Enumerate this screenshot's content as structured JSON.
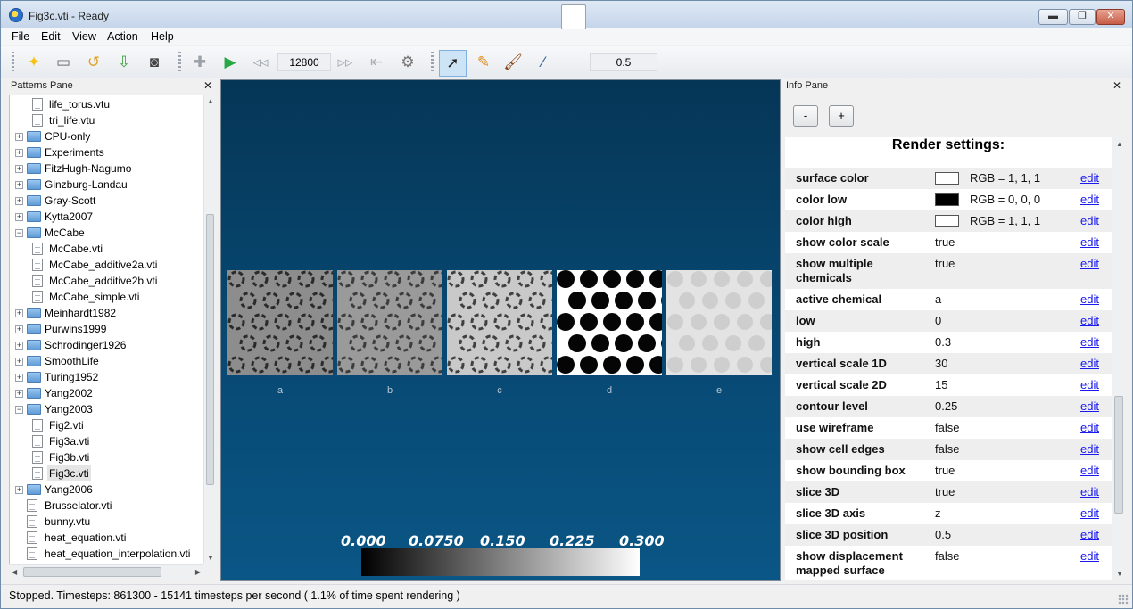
{
  "window": {
    "title": "Fig3c.vti - Ready",
    "minimize": "▬",
    "maximize": "❐",
    "close": "✕"
  },
  "menu": {
    "items": [
      {
        "label": "File"
      },
      {
        "label": "Edit"
      },
      {
        "label": "View"
      },
      {
        "label": "Action"
      },
      {
        "label": "Help"
      }
    ]
  },
  "toolbar": {
    "timesteps_value": "12800",
    "brush_value": "0.5",
    "icons": [
      "new-pattern-icon",
      "open-folder-icon",
      "reload-icon",
      "import-icon",
      "screenshot-icon",
      "add-icon",
      "run-icon",
      "slower-icon",
      "faster-icon",
      "reset-icon",
      "settings-icon",
      "pointer-icon",
      "pencil-icon",
      "brush-icon",
      "eyedropper-icon"
    ]
  },
  "patterns_pane": {
    "title": "Patterns Pane",
    "close": "✕",
    "tree": [
      {
        "label": "life_torus.vtu",
        "type": "file",
        "level": 1
      },
      {
        "label": "tri_life.vtu",
        "type": "file",
        "level": 1
      },
      {
        "label": "CPU-only",
        "type": "folder",
        "level": 0,
        "expanded": false
      },
      {
        "label": "Experiments",
        "type": "folder",
        "level": 0,
        "expanded": false
      },
      {
        "label": "FitzHugh-Nagumo",
        "type": "folder",
        "level": 0,
        "expanded": false
      },
      {
        "label": "Ginzburg-Landau",
        "type": "folder",
        "level": 0,
        "expanded": false
      },
      {
        "label": "Gray-Scott",
        "type": "folder",
        "level": 0,
        "expanded": false
      },
      {
        "label": "Kytta2007",
        "type": "folder",
        "level": 0,
        "expanded": false
      },
      {
        "label": "McCabe",
        "type": "folder",
        "level": 0,
        "expanded": true
      },
      {
        "label": "McCabe.vti",
        "type": "file",
        "level": 1
      },
      {
        "label": "McCabe_additive2a.vti",
        "type": "file",
        "level": 1
      },
      {
        "label": "McCabe_additive2b.vti",
        "type": "file",
        "level": 1
      },
      {
        "label": "McCabe_simple.vti",
        "type": "file",
        "level": 1
      },
      {
        "label": "Meinhardt1982",
        "type": "folder",
        "level": 0,
        "expanded": false
      },
      {
        "label": "Purwins1999",
        "type": "folder",
        "level": 0,
        "expanded": false
      },
      {
        "label": "Schrodinger1926",
        "type": "folder",
        "level": 0,
        "expanded": false
      },
      {
        "label": "SmoothLife",
        "type": "folder",
        "level": 0,
        "expanded": false
      },
      {
        "label": "Turing1952",
        "type": "folder",
        "level": 0,
        "expanded": false
      },
      {
        "label": "Yang2002",
        "type": "folder",
        "level": 0,
        "expanded": false
      },
      {
        "label": "Yang2003",
        "type": "folder",
        "level": 0,
        "expanded": true
      },
      {
        "label": "Fig2.vti",
        "type": "file",
        "level": 1
      },
      {
        "label": "Fig3a.vti",
        "type": "file",
        "level": 1
      },
      {
        "label": "Fig3b.vti",
        "type": "file",
        "level": 1
      },
      {
        "label": "Fig3c.vti",
        "type": "file",
        "level": 1,
        "selected": true
      },
      {
        "label": "Yang2006",
        "type": "folder",
        "level": 0,
        "expanded": false
      },
      {
        "label": "Brusselator.vti",
        "type": "file",
        "level": 0
      },
      {
        "label": "bunny.vtu",
        "type": "file",
        "level": 0
      },
      {
        "label": "heat_equation.vti",
        "type": "file",
        "level": 0
      },
      {
        "label": "heat_equation_interpolation.vti",
        "type": "file",
        "level": 0
      }
    ]
  },
  "render_view": {
    "tiles": [
      {
        "label": "a",
        "style": "spiral-dark"
      },
      {
        "label": "b",
        "style": "spiral-mid"
      },
      {
        "label": "c",
        "style": "spiral-light"
      },
      {
        "label": "d",
        "style": "spots"
      },
      {
        "label": "e",
        "style": "faint"
      }
    ],
    "color_scale_labels": [
      "0.000",
      "0.0750",
      "0.150",
      "0.225",
      "0.300"
    ]
  },
  "info_pane": {
    "title": "Info Pane",
    "close": "✕",
    "minus_button": "-",
    "plus_button": "+",
    "heading": "Render settings:",
    "edit_label": "edit",
    "rows": [
      {
        "key": "surface color",
        "swatch": "#ffffff",
        "value": "RGB = 1, 1, 1"
      },
      {
        "key": "color low",
        "swatch": "#000000",
        "value": "RGB = 0, 0, 0"
      },
      {
        "key": "color high",
        "swatch": "#ffffff",
        "value": "RGB = 1, 1, 1"
      },
      {
        "key": "show color scale",
        "value": "true"
      },
      {
        "key": "show multiple chemicals",
        "value": "true",
        "tall": true
      },
      {
        "key": "active chemical",
        "value": "a"
      },
      {
        "key": "low",
        "value": "0"
      },
      {
        "key": "high",
        "value": "0.3"
      },
      {
        "key": "vertical scale 1D",
        "value": "30"
      },
      {
        "key": "vertical scale 2D",
        "value": "15"
      },
      {
        "key": "contour level",
        "value": "0.25"
      },
      {
        "key": "use wireframe",
        "value": "false"
      },
      {
        "key": "show cell edges",
        "value": "false"
      },
      {
        "key": "show bounding box",
        "value": "true"
      },
      {
        "key": "slice 3D",
        "value": "true"
      },
      {
        "key": "slice 3D axis",
        "value": "z"
      },
      {
        "key": "slice 3D position",
        "value": "0.5"
      },
      {
        "key": "show displacement mapped surface",
        "value": "false",
        "tall": true
      }
    ]
  },
  "status": {
    "text": "Stopped. Timesteps: 861300  -  15141 timesteps per second   ( 1.1% of time spent rendering )"
  }
}
